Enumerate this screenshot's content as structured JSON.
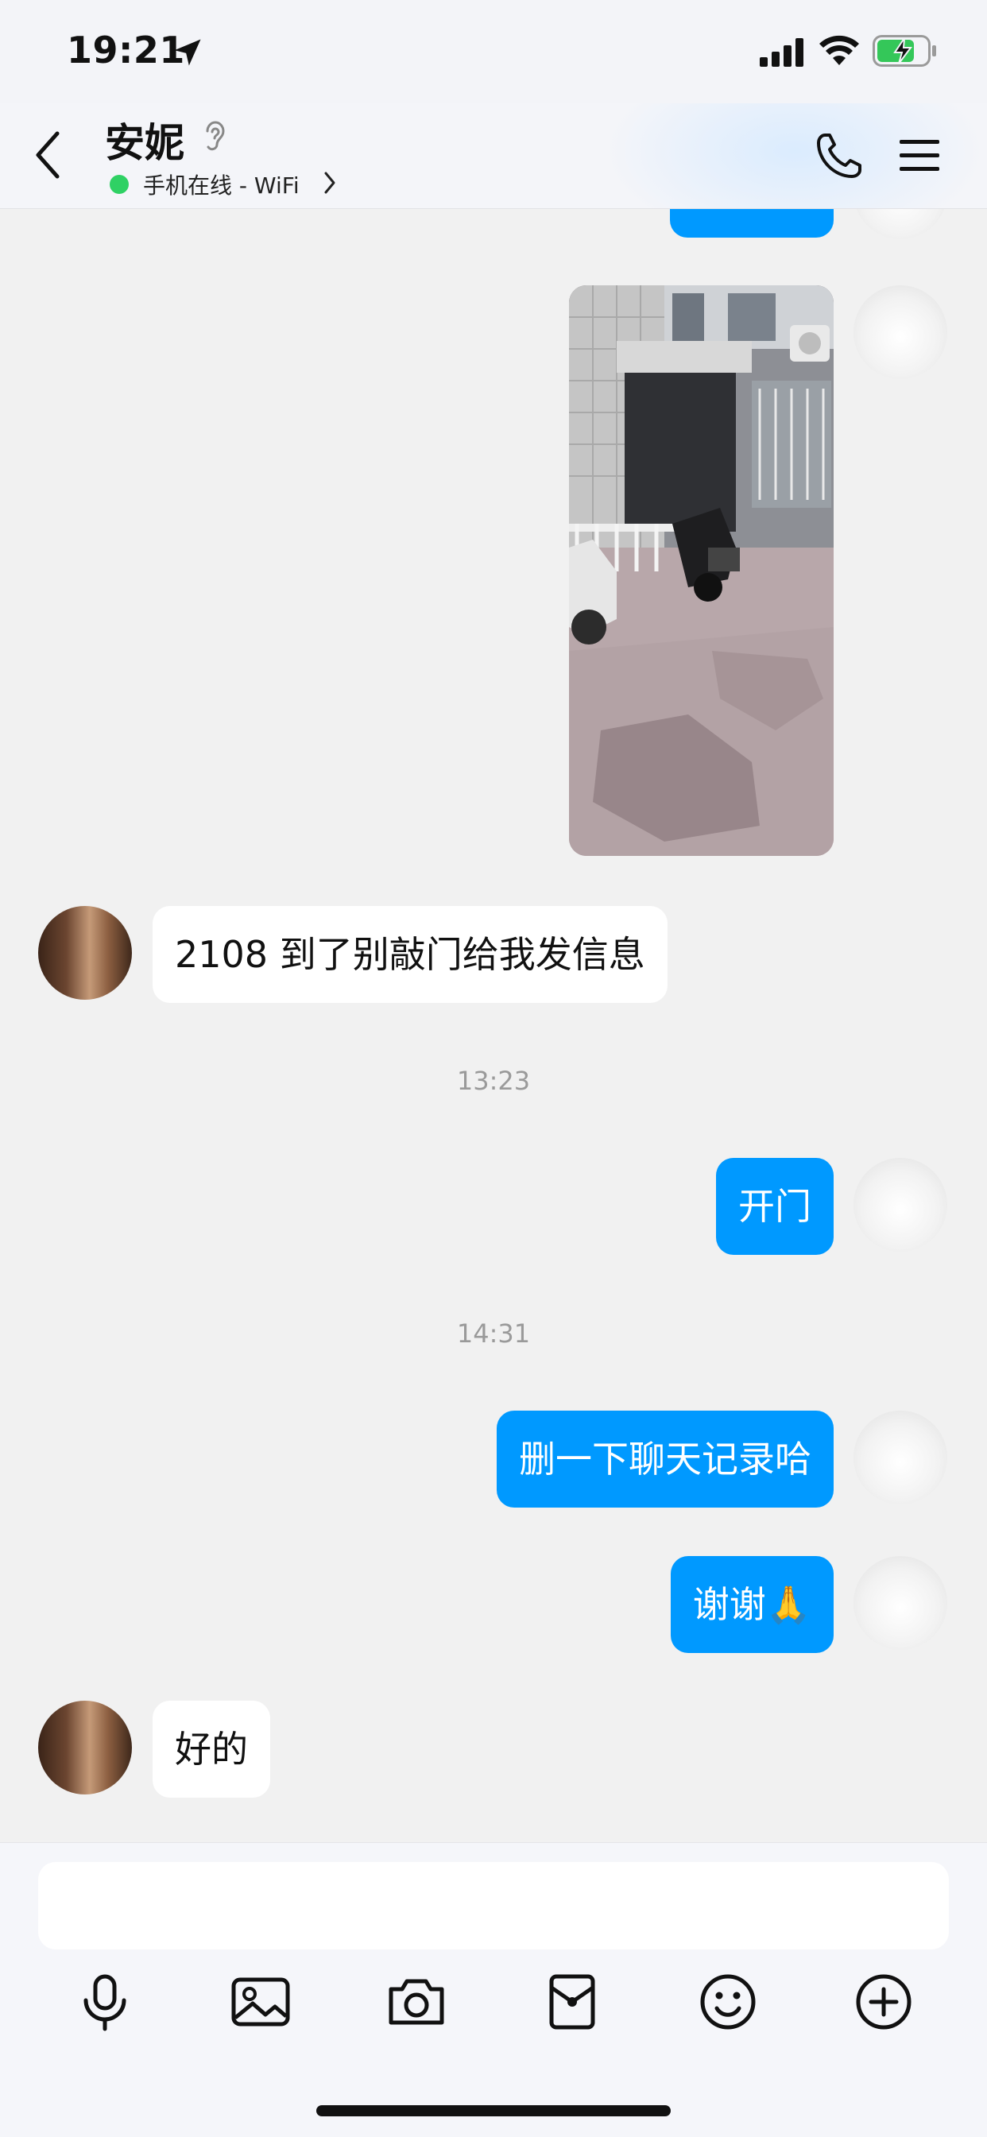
{
  "status_bar": {
    "time": "19:21"
  },
  "header": {
    "contact_name": "安妮",
    "status": "手机在线 - WiFi"
  },
  "messages": [
    {
      "id": "m1",
      "direction": "outgoing",
      "type": "text",
      "text": ""
    },
    {
      "id": "m2",
      "direction": "outgoing",
      "type": "image"
    },
    {
      "id": "m3",
      "direction": "incoming",
      "type": "text",
      "text": "2108 到了别敲门给我发信息"
    },
    {
      "id": "t1",
      "type": "timestamp",
      "text": "13:23"
    },
    {
      "id": "m4",
      "direction": "outgoing",
      "type": "text",
      "text": "开门"
    },
    {
      "id": "t2",
      "type": "timestamp",
      "text": "14:31"
    },
    {
      "id": "m5",
      "direction": "outgoing",
      "type": "text",
      "text": "删一下聊天记录哈"
    },
    {
      "id": "m6",
      "direction": "outgoing",
      "type": "text",
      "text": "谢谢🙏"
    },
    {
      "id": "m7",
      "direction": "incoming",
      "type": "text",
      "text": "好的"
    }
  ],
  "input": {
    "value": ""
  },
  "toolbar": [
    "microphone-icon",
    "image-icon",
    "camera-icon",
    "red-packet-icon",
    "emoji-icon",
    "plus-icon"
  ],
  "colors": {
    "outgoing_bubble": "#0099ff",
    "incoming_bubble": "#ffffff",
    "background": "#f1f1f1",
    "online": "#2fd164"
  }
}
